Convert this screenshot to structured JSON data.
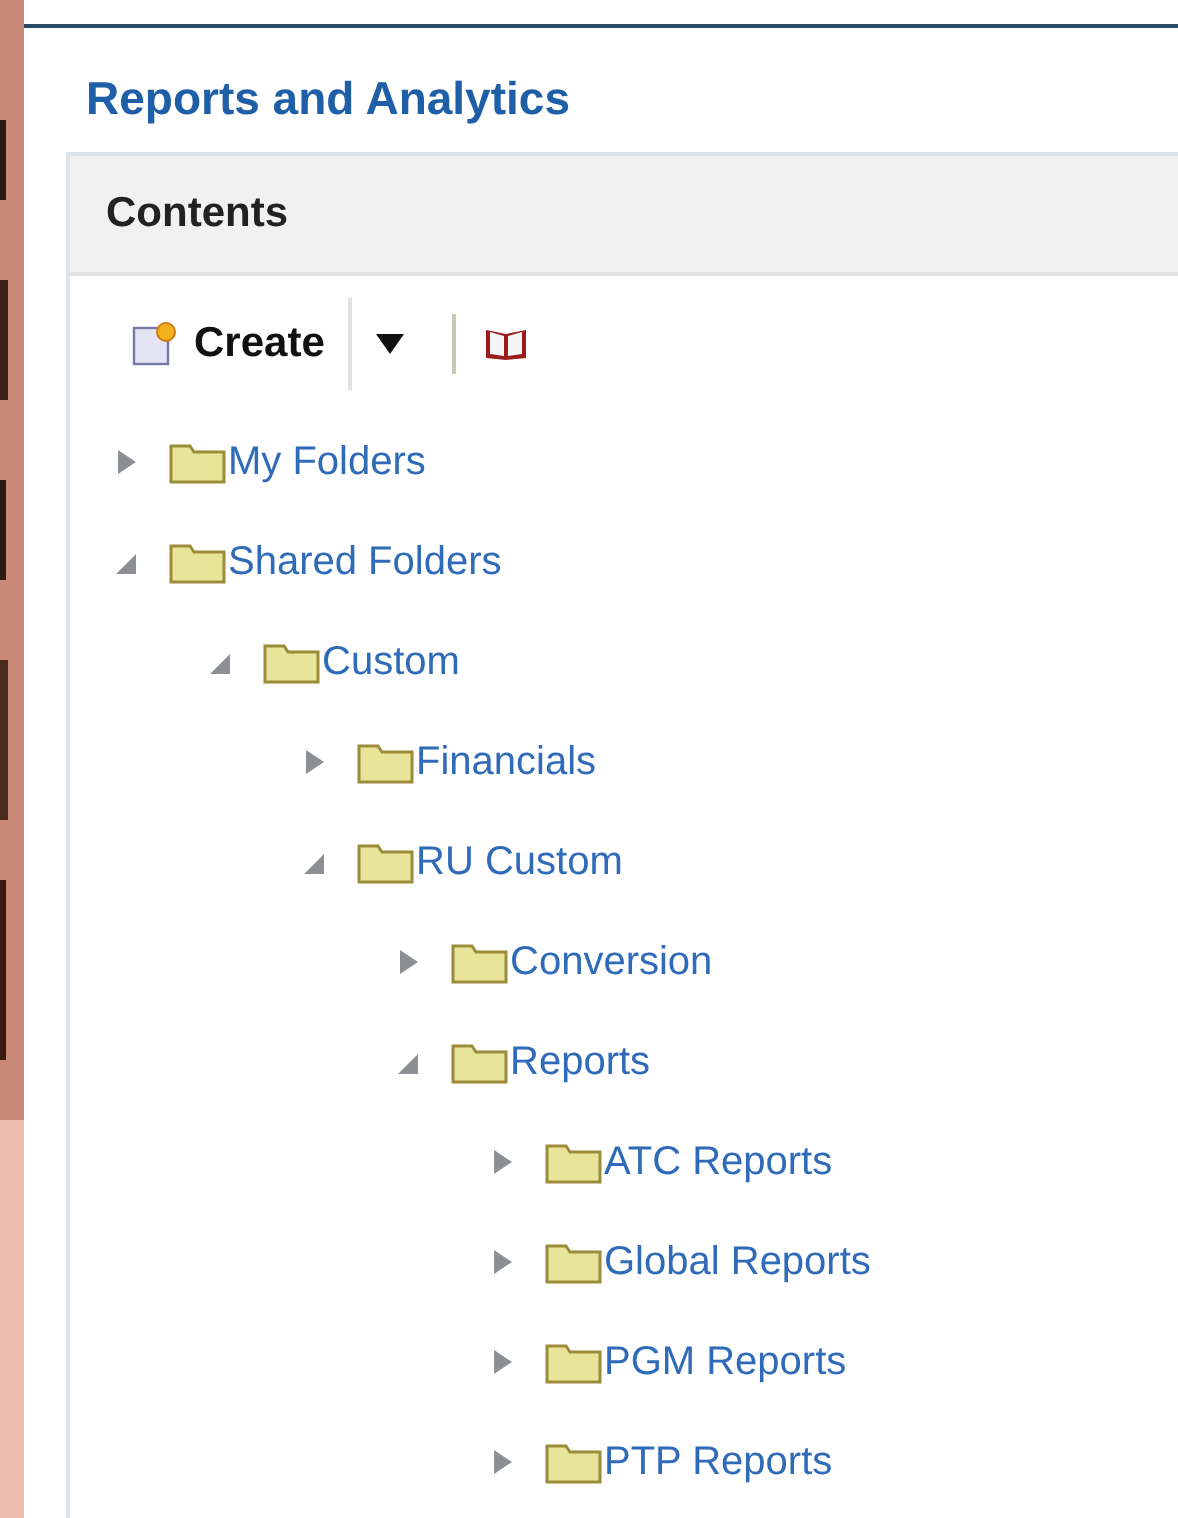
{
  "page_title": "Reports and Analytics",
  "panel": {
    "title": "Contents"
  },
  "toolbar": {
    "create_label": "Create"
  },
  "tree": [
    {
      "label": "My Folders",
      "expanded": false
    },
    {
      "label": "Shared Folders",
      "expanded": true,
      "children": [
        {
          "label": "Custom",
          "expanded": true,
          "children": [
            {
              "label": "Financials",
              "expanded": false
            },
            {
              "label": "RU Custom",
              "expanded": true,
              "children": [
                {
                  "label": "Conversion",
                  "expanded": false
                },
                {
                  "label": "Reports",
                  "expanded": true,
                  "children": [
                    {
                      "label": "ATC Reports",
                      "expanded": false
                    },
                    {
                      "label": "Global Reports",
                      "expanded": false
                    },
                    {
                      "label": "PGM Reports",
                      "expanded": false
                    },
                    {
                      "label": "PTP Reports",
                      "expanded": false
                    }
                  ]
                }
              ]
            }
          ]
        }
      ]
    }
  ]
}
